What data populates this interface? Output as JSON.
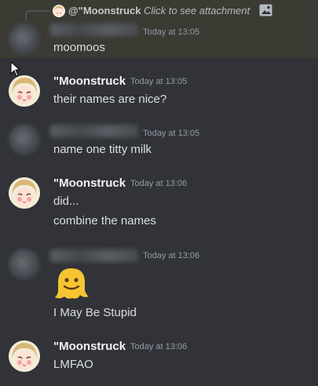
{
  "reply": {
    "author": "@\"Moonstruck",
    "text": "Click to see attachment",
    "attachment_icon": "image-icon"
  },
  "messages": [
    {
      "author": "",
      "author_blurred": true,
      "timestamp": "Today at 13:05",
      "lines": [
        "moomoos"
      ],
      "highlighted": true
    },
    {
      "author": "\"Moonstruck",
      "timestamp": "Today at 13:05",
      "lines": [
        "their names are nice?"
      ]
    },
    {
      "author": "",
      "author_blurred": true,
      "timestamp": "Today at 13:05",
      "lines": [
        "name one titty milk"
      ]
    },
    {
      "author": "\"Moonstruck",
      "timestamp": "Today at 13:06",
      "lines": [
        "did...",
        "combine the names"
      ]
    },
    {
      "author": "",
      "author_blurred": true,
      "timestamp": "Today at 13:06",
      "lines": [
        "I May Be Stupid"
      ],
      "emoji": "melting-face"
    },
    {
      "author": "\"Moonstruck",
      "timestamp": "Today at 13:06",
      "lines": [
        "LMFAO"
      ]
    }
  ],
  "colors": {
    "background": "#313338",
    "highlight": "#3b3a33",
    "text": "#dbdee1",
    "timestamp": "#949ba4",
    "author": "#f2f3f5"
  }
}
